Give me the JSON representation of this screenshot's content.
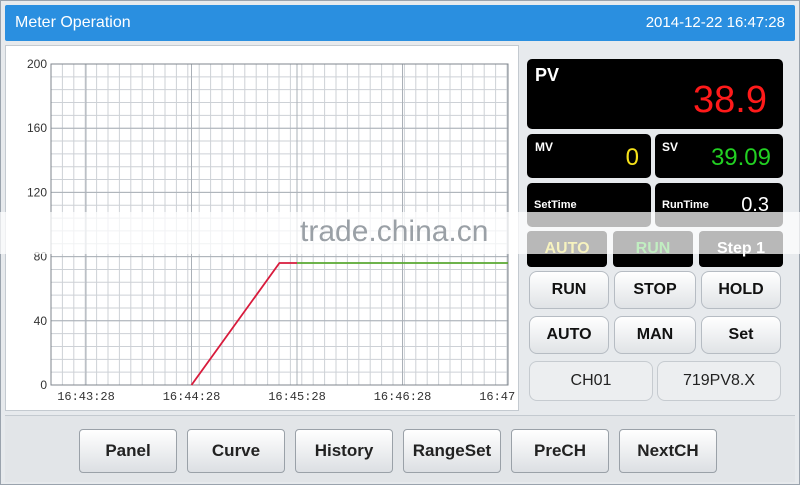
{
  "header": {
    "title": "Meter Operation",
    "datetime": "2014-12-22 16:47:28"
  },
  "chart_data": {
    "type": "line",
    "ylim": [
      0,
      200
    ],
    "yticks": [
      0,
      40,
      80,
      120,
      160,
      200
    ],
    "xlim_seconds": [
      0,
      240
    ],
    "xticks": [
      {
        "s": 0,
        "label": "16:43:28"
      },
      {
        "s": 60,
        "label": "16:44:28"
      },
      {
        "s": 120,
        "label": "16:45:28"
      },
      {
        "s": 180,
        "label": "16:46:28"
      },
      {
        "s": 240,
        "label": "16:47:28"
      }
    ],
    "grid": true,
    "series": [
      {
        "color": "#d81b3c",
        "points": [
          [
            60,
            0
          ],
          [
            110,
            76
          ],
          [
            120,
            76
          ]
        ]
      },
      {
        "color": "#5aa832",
        "points": [
          [
            120,
            76
          ],
          [
            240,
            76
          ]
        ]
      }
    ]
  },
  "display": {
    "pv": {
      "label": "PV",
      "value": "38.9",
      "value_color": "#ff1a1a"
    },
    "mv": {
      "label": "MV",
      "value": "0",
      "value_color": "#f6e21a"
    },
    "sv": {
      "label": "SV",
      "value": "39.09",
      "value_color": "#22d022"
    },
    "settime": {
      "label": "SetTime",
      "value": ""
    },
    "runtime": {
      "label": "RunTime",
      "value": "0.3"
    },
    "modes": [
      {
        "label": "AUTO",
        "color": "#e0d21a"
      },
      {
        "label": "RUN",
        "color": "#22c022"
      },
      {
        "label": "Step 1",
        "color": "#ffffff"
      }
    ]
  },
  "controls": {
    "run": "RUN",
    "stop": "STOP",
    "hold": "HOLD",
    "auto": "AUTO",
    "man": "MAN",
    "set": "Set"
  },
  "channel": {
    "name": "CH01",
    "model": "719PV8.X"
  },
  "toolbar": {
    "panel": "Panel",
    "curve": "Curve",
    "history": "History",
    "rangeset": "RangeSet",
    "prech": "PreCH",
    "nextch": "NextCH"
  },
  "watermark": "trade.china.cn"
}
